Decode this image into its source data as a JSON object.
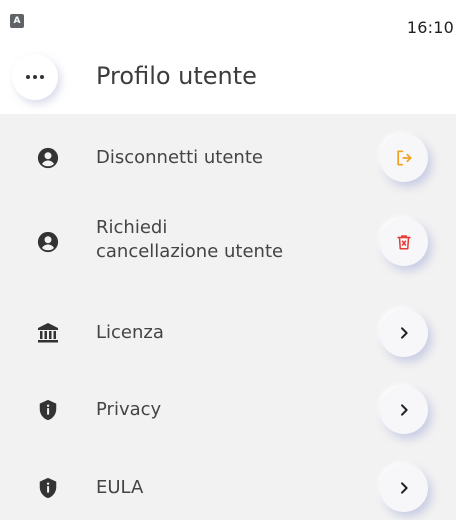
{
  "status_bar": {
    "app_icon_letter": "A",
    "time": "16:10"
  },
  "header": {
    "title": "Profilo utente",
    "menu_icon": "more-horizontal-icon"
  },
  "menu_items": [
    {
      "label": "Disconnetti utente",
      "icon": "user-circle-icon",
      "action_icon": "logout-icon",
      "action_color": "#f0a11e"
    },
    {
      "label_line1": "Richiedi",
      "label_line2": "cancellazione utente",
      "icon": "user-circle-icon",
      "action_icon": "trash-icon",
      "action_color": "#e53935"
    },
    {
      "label": "Licenza",
      "icon": "bank-icon",
      "action_icon": "chevron-right-icon",
      "action_color": "#222222"
    },
    {
      "label": "Privacy",
      "icon": "shield-info-icon",
      "action_icon": "chevron-right-icon",
      "action_color": "#222222"
    },
    {
      "label": "EULA",
      "icon": "shield-info-icon",
      "action_icon": "chevron-right-icon",
      "action_color": "#222222"
    }
  ]
}
